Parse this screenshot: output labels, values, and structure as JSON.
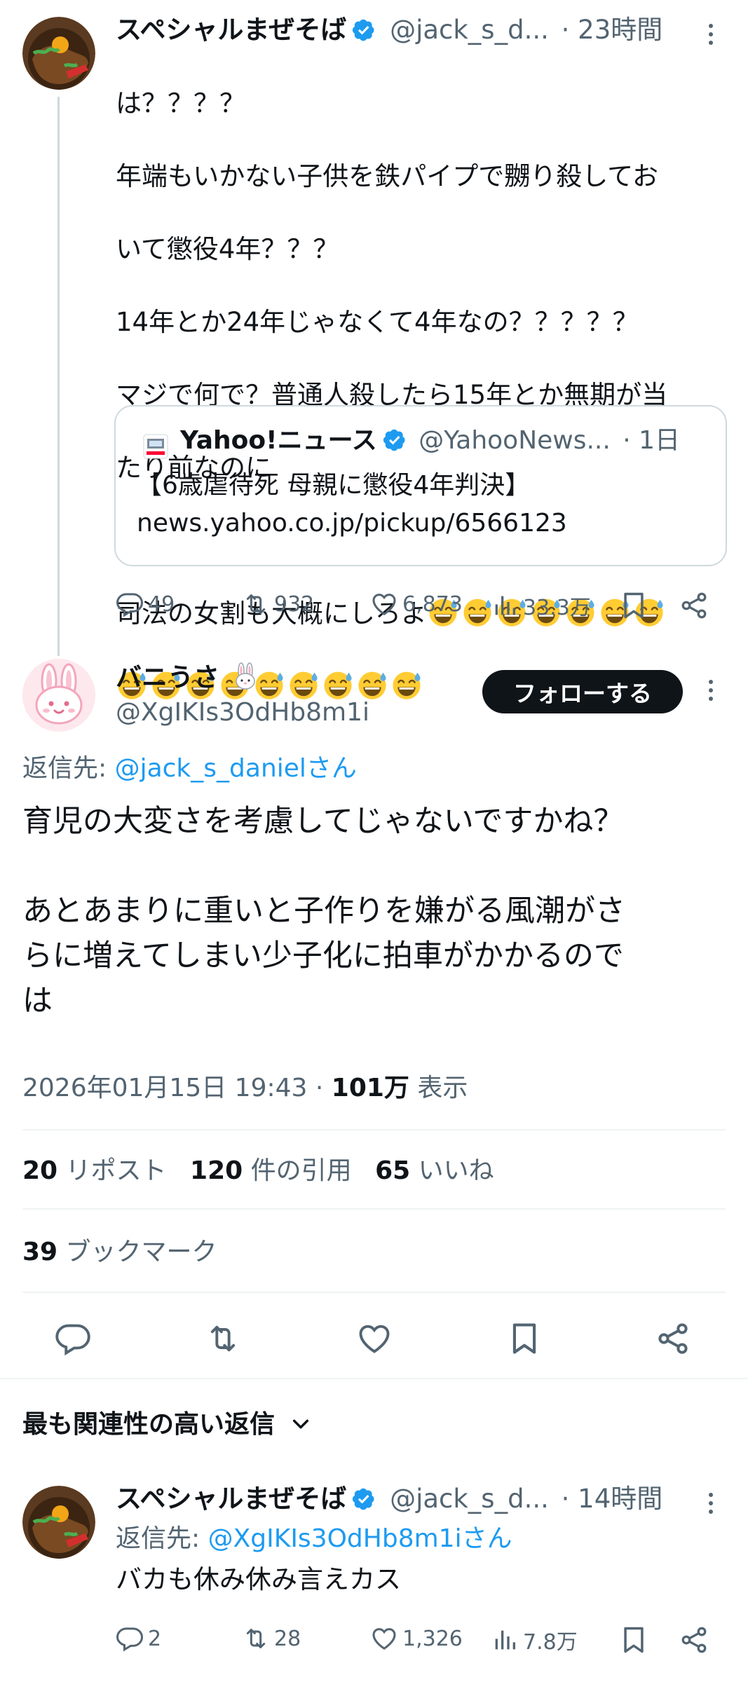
{
  "tweet1": {
    "name": "スペシャルまぜそば",
    "handle": "@jack_s_d...",
    "time": "· 23時間",
    "lines": [
      "は？？？？",
      "年端もいかない子供を鉄パイプで嬲り殺してお",
      "いて懲役4年？？？",
      "14年とか24年じゃなくて4年なの？？？？？",
      "マジで何で？普通人殺したら15年とか無期が当",
      "たり前なのに"
    ],
    "last_line": "司法の女割も大概にしろよ",
    "emoji_row1_count": 7,
    "emoji_row2_count": 9,
    "quote": {
      "name": "Yahoo!ニュース",
      "handle": "@YahooNews...",
      "time": "· 1日",
      "headline": "【6歳虐待死 母親に懲役4年判決】",
      "url": "news.yahoo.co.jp/pickup/6566123"
    },
    "replies": "49",
    "reposts": "932",
    "likes": "6,873",
    "views": "33.3万"
  },
  "main_tweet": {
    "name": "バニうさ",
    "name_emoji": "rabbit-face",
    "handle": "@XgIKIs3OdHb8m1i",
    "follow_label": "フォローする",
    "reply_to_prefix": "返信先: ",
    "reply_to_handle": "@jack_s_danielさん",
    "body": [
      "育児の大変さを考慮してじゃないですかね？",
      "",
      "あとあまりに重いと子作りを嫌がる風潮がさ",
      "らに増えてしまい少子化に拍車がかかるので",
      "は"
    ],
    "timestamp": "2026年01月15日 19:43",
    "separator": " · ",
    "view_count": "101万",
    "view_label": " 表示",
    "stats": [
      {
        "count": "20",
        "label": " リポスト"
      },
      {
        "count": "120",
        "label": " 件の引用"
      },
      {
        "count": "65",
        "label": " いいね"
      }
    ],
    "bookmark_count": "39",
    "bookmark_label": " ブックマーク"
  },
  "sort": {
    "label": "最も関連性の高い返信"
  },
  "reply": {
    "name": "スペシャルまぜそば",
    "handle": "@jack_s_d...",
    "time": "· 14時間",
    "reply_to_prefix": "返信先: ",
    "reply_to_handle": "@XgIKIs3OdHb8m1iさん",
    "body": "バカも休み休み言えカス",
    "replies": "2",
    "reposts": "28",
    "likes": "1,326",
    "views": "7.8万"
  },
  "colors": {
    "accent": "#1d9bf0",
    "text": "#0f1419",
    "muted": "#536471",
    "divider": "#eff3f4",
    "follow_bg": "#0f1419"
  }
}
